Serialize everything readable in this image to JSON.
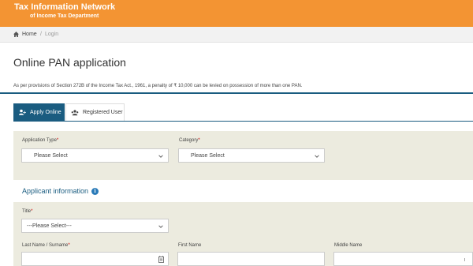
{
  "header": {
    "title": "Tax Information Network",
    "subtitle": "of Income Tax Department",
    "background": "#f39433"
  },
  "breadcrumb": {
    "home": "Home",
    "separator": "/",
    "current": "Login"
  },
  "page": {
    "title": "Online PAN application",
    "notice": "As per provisions of Section 272B of the Income Tax Act., 1961, a penalty of ₹ 10,000 can be levied on possession of more than one PAN."
  },
  "tabs": [
    {
      "label": "Apply Online",
      "icon": "user-plus-icon",
      "active": true
    },
    {
      "label": "Registered User",
      "icon": "user-group-icon",
      "active": false
    }
  ],
  "form": {
    "application_type": {
      "label": "Application Type",
      "required_mark": "*",
      "value": "Please Select"
    },
    "category": {
      "label": "Category",
      "required_mark": "*",
      "value": "Please Select"
    },
    "applicant_section": {
      "title": "Applicant information",
      "icon": "info-icon",
      "icon_glyph": "i"
    },
    "title": {
      "label": "Title",
      "required_mark": "*",
      "value": "---Please Select---"
    },
    "last_name": {
      "label": "Last Name / Surname",
      "required_mark": "*",
      "value": "",
      "icon": "calendar-icon"
    },
    "first_name": {
      "label": "First Name",
      "value": ""
    },
    "middle_name": {
      "label": "Middle Name",
      "value": ""
    },
    "edge_text": "I"
  },
  "colors": {
    "accent": "#1a5c80",
    "panel": "#ecebdf",
    "required": "#cc0000"
  }
}
